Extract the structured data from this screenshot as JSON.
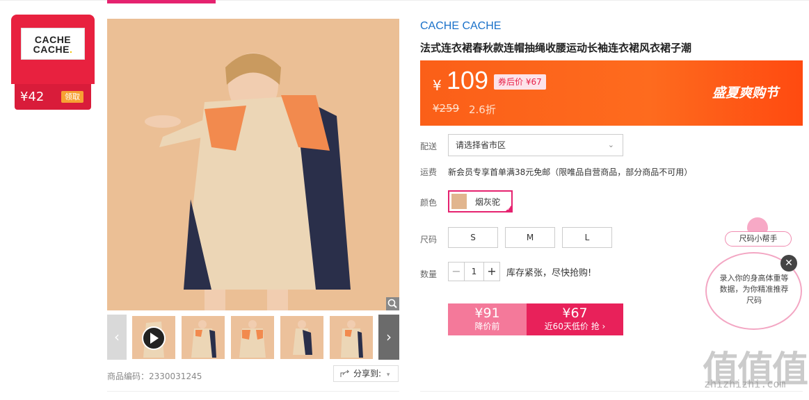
{
  "coupon": {
    "logo_line1": "CACHE",
    "logo_line2": "CACHE",
    "amount": "¥42",
    "claim_label": "领取"
  },
  "product": {
    "brand": "CACHE CACHE",
    "title": "法式连衣裙春秋款连帽抽绳收腰运动长袖连衣裙风衣裙子潮",
    "code_label": "商品编码：2330031245",
    "share_label": "分享到:"
  },
  "price": {
    "currency": "¥",
    "current": "109",
    "after_coupon": "券后价 ¥67",
    "original": "¥259",
    "discount": "2.6折",
    "promo": "盛夏爽购节",
    "accent": "#fe6b1e"
  },
  "delivery": {
    "label": "配送",
    "placeholder": "请选择省市区"
  },
  "shipping": {
    "label": "运费",
    "text": "新会员专享首单满38元免邮（限唯品自营商品，部分商品不可用）"
  },
  "color": {
    "label": "颜色",
    "option": "烟灰驼"
  },
  "size": {
    "label": "尺码",
    "options": [
      "S",
      "M",
      "L"
    ]
  },
  "quantity": {
    "label": "数量",
    "minus": "−",
    "value": "1",
    "plus": "+",
    "stock_note": "库存紧张，尽快抢购!"
  },
  "buy": {
    "left_price": "¥91",
    "left_label": "降价前",
    "right_price": "¥67",
    "right_label": "近60天低价 抢 ›"
  },
  "helper": {
    "tag": "尺码小帮手",
    "text": "录入你的身高体重等数据，为你精准推荐尺码",
    "close": "✕"
  },
  "watermark": {
    "chars": "值值值",
    "url": "zhizhizhi.com"
  }
}
